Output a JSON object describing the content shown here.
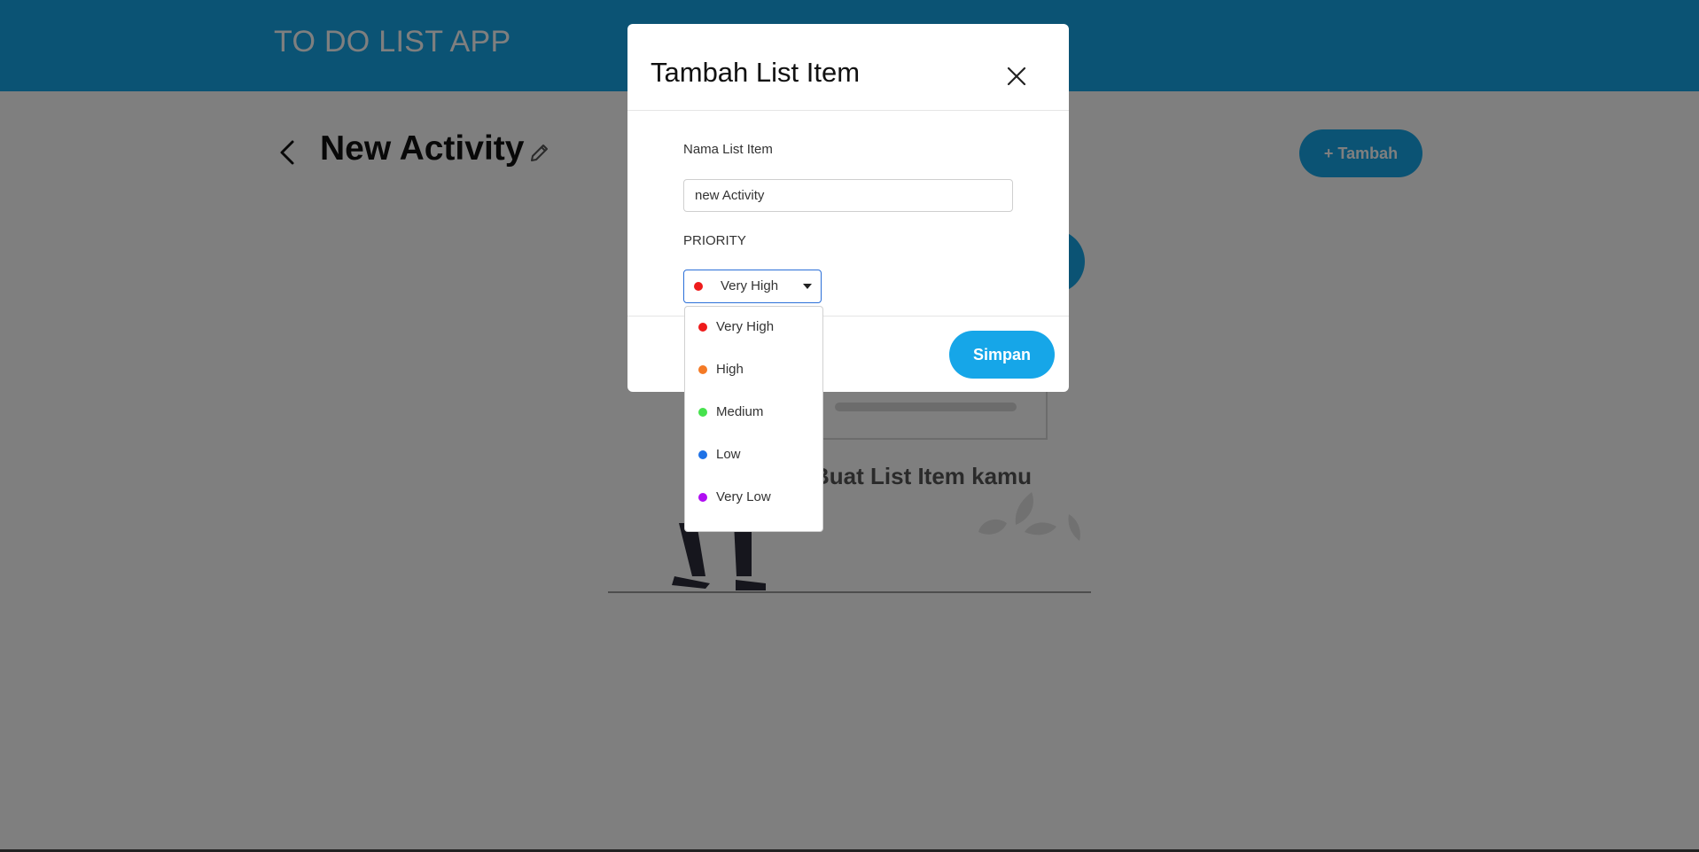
{
  "header": {
    "app_title": "TO DO LIST APP"
  },
  "page": {
    "activity_title": "New Activity",
    "add_button_label": "+ Tambah",
    "empty_state_text": "Buat List Item kamu"
  },
  "modal": {
    "title": "Tambah List Item",
    "name_label": "Nama List Item",
    "name_value": "new Activity",
    "priority_label": "PRIORITY",
    "selected_priority": {
      "label": "Very High",
      "color": "#ee1b1b"
    },
    "save_label": "Simpan"
  },
  "priority_options": [
    {
      "label": "Very High",
      "color": "#ee1b1b"
    },
    {
      "label": "High",
      "color": "#f47a25"
    },
    {
      "label": "Medium",
      "color": "#46e24d"
    },
    {
      "label": "Low",
      "color": "#1f72e6"
    },
    {
      "label": "Very Low",
      "color": "#b00ef2"
    }
  ],
  "colors": {
    "accent": "#16a6e8",
    "select_border": "#2b6fd8"
  },
  "icons": [
    "back-icon",
    "pencil-icon",
    "close-icon",
    "caret-down-icon"
  ]
}
